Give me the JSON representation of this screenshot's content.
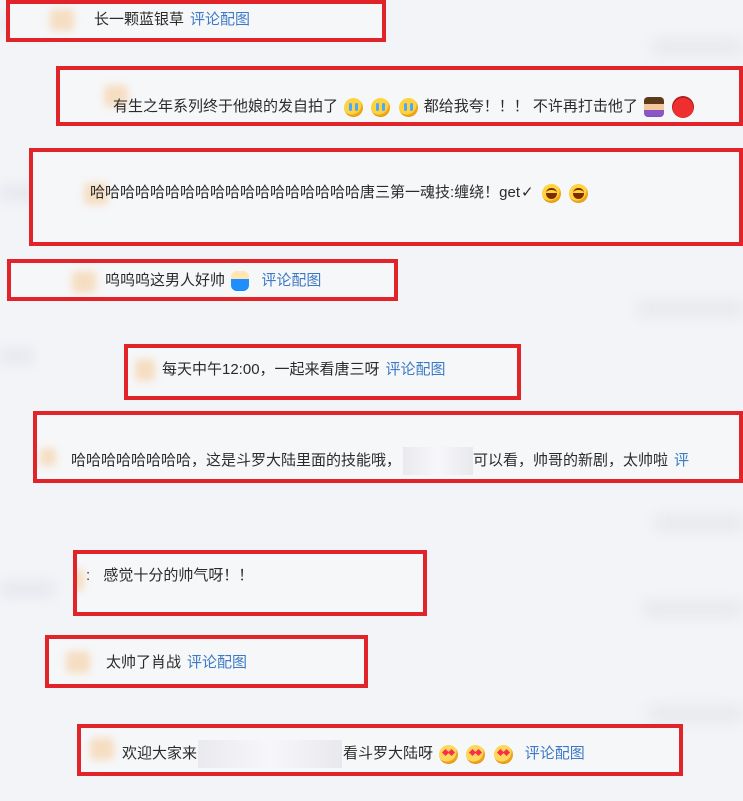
{
  "comments": [
    {
      "text": "长一颗蓝银草",
      "link": "评论配图"
    },
    {
      "text": "有生之年系列终于他娘的发自拍了",
      "suffix": "都给我夸！！！ 不许再打击他了",
      "emojis": [
        "cry-emoji",
        "cry-emoji",
        "cry-emoji",
        "woman-emoji",
        "angry-bird-emoji"
      ]
    },
    {
      "text": "哈哈哈哈哈哈哈哈哈哈哈哈哈哈哈哈哈哈唐三第一魂技:缠绕！get",
      "check": "✓",
      "emojis": [
        "laugh-emoji",
        "laugh-emoji"
      ]
    },
    {
      "text": "呜呜呜这男人好帅",
      "link": "评论配图",
      "emojis": [
        "person-emoji"
      ]
    },
    {
      "text": "每天中午12:00，一起来看唐三呀",
      "link": "评论配图"
    },
    {
      "text_before": "哈哈哈哈哈哈哈哈，这是斗罗大陆里面的技能哦，",
      "text_after": "可以看，帅哥的新剧，太帅啦",
      "link": "评"
    },
    {
      "prefix": ":",
      "text": "感觉十分的帅气呀！！"
    },
    {
      "text": "太帅了肖战",
      "link": "评论配图"
    },
    {
      "text_before": "欢迎大家来",
      "text_after": "看斗罗大陆呀",
      "link": "评论配图",
      "emojis": [
        "heart-emoji",
        "heart-emoji",
        "heart-emoji"
      ]
    }
  ]
}
